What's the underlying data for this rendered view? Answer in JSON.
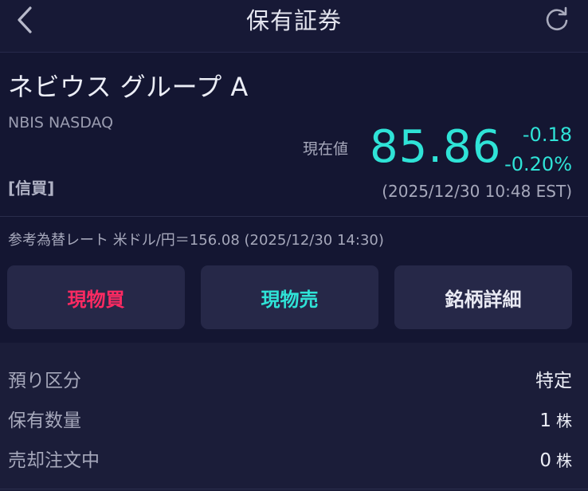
{
  "navbar": {
    "title": "保有証券",
    "back_icon": "chevron-left-icon",
    "refresh_icon": "refresh-icon"
  },
  "security": {
    "name": "ネビウス グループ A",
    "code": "NBIS NASDAQ",
    "tag": "[信買]",
    "price_label": "現在値",
    "price": "85.86",
    "change_abs": "-0.18",
    "change_pct": "-0.20%",
    "timestamp": "(2025/12/30 10:48 EST)"
  },
  "exchange_rate": {
    "text": "参考為替レート 米ドル/円＝156.08 (2025/12/30 14:30)"
  },
  "actions": {
    "buy_label": "現物買",
    "sell_label": "現物売",
    "detail_label": "銘柄詳細"
  },
  "holdings": {
    "rows": [
      {
        "label": "預り区分",
        "value": "特定",
        "unit": ""
      },
      {
        "label": "保有数量",
        "value": "1",
        "unit": "株"
      },
      {
        "label": "売却注文中",
        "value": "0",
        "unit": "株"
      }
    ]
  },
  "colors": {
    "background": "#141632",
    "positive_accent": "#2fe3d7",
    "buy_accent": "#ff2a62",
    "button_bg": "#262848"
  }
}
